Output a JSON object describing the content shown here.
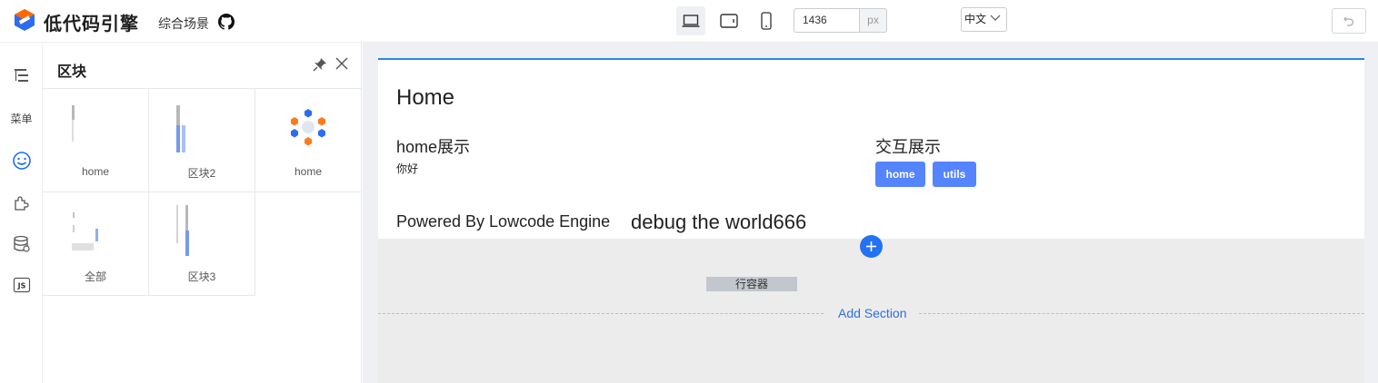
{
  "header": {
    "logo_text": "低代码引擎",
    "scene_label": "综合场景",
    "width_value": "1436",
    "width_unit": "px",
    "lang": "中文"
  },
  "rail": {
    "menu_label": "菜单"
  },
  "panel": {
    "title": "区块",
    "blocks": [
      {
        "label": "home"
      },
      {
        "label": "区块2"
      },
      {
        "label": "home"
      },
      {
        "label": "全部"
      },
      {
        "label": "区块3"
      }
    ]
  },
  "canvas": {
    "page_title": "Home",
    "home_section": "home展示",
    "hello_text": "你好",
    "interact_section": "交互展示",
    "buttons": [
      "home",
      "utils"
    ],
    "powered_text": "Powered By Lowcode Engine",
    "debug_text": "debug the world666",
    "container_tag": "行容器",
    "add_section": "Add Section"
  },
  "colors": {
    "accent": "#5584ff",
    "primary_blue": "#2272f2",
    "page_border": "#2d86e5",
    "link": "#2d6fe0"
  }
}
